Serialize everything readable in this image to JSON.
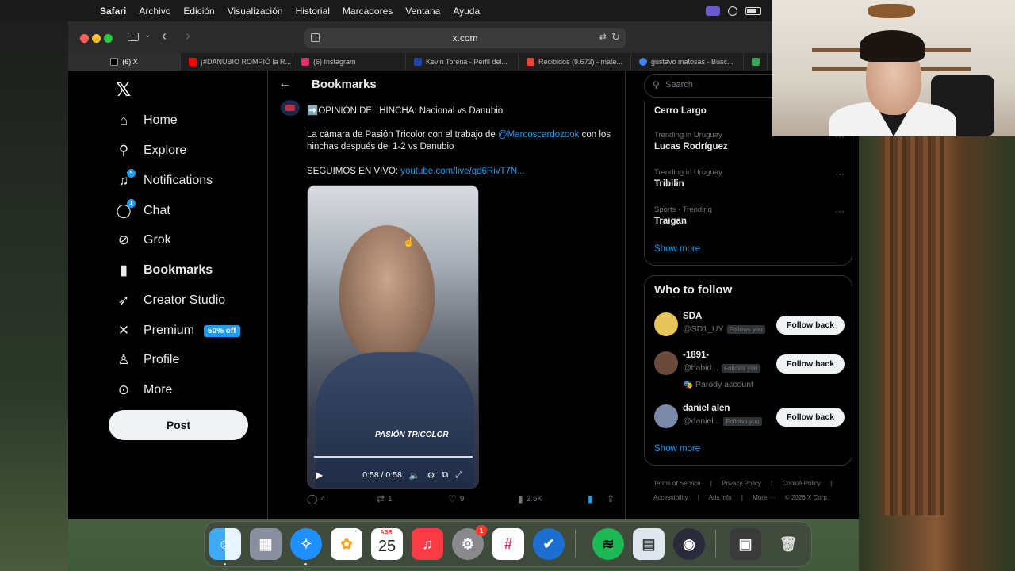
{
  "menubar": {
    "app": "Safari",
    "items": [
      "Archivo",
      "Edición",
      "Visualización",
      "Historial",
      "Marcadores",
      "Ventana",
      "Ayuda"
    ]
  },
  "browser": {
    "url": "x.com",
    "tabs": [
      {
        "label": "(6) X",
        "color": "#ffffff"
      },
      {
        "label": "¡#DANUBIO ROMPIÓ la R...",
        "color": "#ff0000"
      },
      {
        "label": "(6) Instagram",
        "color": "#e1306c"
      },
      {
        "label": "Kevin Torena - Perfil del...",
        "color": "#2244aa"
      },
      {
        "label": "Recibidos (9.673) - mate...",
        "color": "#ea4335"
      },
      {
        "label": "gustavo matosas - Busc...",
        "color": "#4285f4"
      },
      {
        "label": "",
        "color": "#34a853"
      }
    ]
  },
  "nav": {
    "items": [
      {
        "label": "Home",
        "icon": "home-icon",
        "glyph": "⌂"
      },
      {
        "label": "Explore",
        "icon": "search-icon",
        "glyph": "⚲"
      },
      {
        "label": "Notifications",
        "icon": "bell-icon",
        "glyph": "🔔",
        "badge": "5"
      },
      {
        "label": "Chat",
        "icon": "chat-icon",
        "glyph": "💬",
        "badge": "1"
      },
      {
        "label": "Grok",
        "icon": "grok-icon",
        "glyph": "⊘"
      },
      {
        "label": "Bookmarks",
        "icon": "bookmark-icon",
        "glyph": "🔖"
      },
      {
        "label": "Creator Studio",
        "icon": "rocket-icon",
        "glyph": "🚀"
      },
      {
        "label": "Premium",
        "icon": "x-icon",
        "glyph": "𝕏"
      },
      {
        "label": "Profile",
        "icon": "person-icon",
        "glyph": "👤"
      },
      {
        "label": "More",
        "icon": "more-icon",
        "glyph": "⋯"
      }
    ],
    "premium_badge": "50% off",
    "post_label": "Post"
  },
  "main": {
    "title": "Bookmarks",
    "tweet": {
      "headline": "➡️OPINIÓN DEL HINCHA: Nacional vs Danubio",
      "body_pre": "La cámara de Pasión Tricolor con el trabajo de ",
      "mention": "@Marcoscardozook",
      "body_post": " con los hinchas después del 1-2 vs Danubio",
      "live_pre": "SEGUIMOS EN VIVO: ",
      "live_link": "youtube.com/live/qd6RivT7N...",
      "video_logo": "PASIÓN TRICOLOR",
      "video_time": "0:58 / 0:58",
      "replies": "4",
      "reposts": "1",
      "likes": "9",
      "views": "2.6K"
    }
  },
  "right": {
    "search_placeholder": "Search",
    "trends": [
      {
        "meta": "",
        "name": "Cerro Largo"
      },
      {
        "meta": "Trending in Uruguay",
        "name": "Lucas Rodríguez"
      },
      {
        "meta": "Trending in Uruguay",
        "name": "Tribilin"
      },
      {
        "meta": "Sports · Trending",
        "name": "Traigan"
      }
    ],
    "show_more": "Show more",
    "who_to_follow": "Who to follow",
    "follow": [
      {
        "name": "SDA",
        "handle": "@SD1_UY",
        "tag": "Follows you",
        "extra": "",
        "button": "Follow back"
      },
      {
        "name": "-1891-",
        "handle": "@babid...",
        "tag": "Follows you",
        "extra": "🎭 Parody account",
        "button": "Follow back"
      },
      {
        "name": "daniel alen",
        "handle": "@daniel...",
        "tag": "Follows you",
        "extra": "",
        "button": "Follow back"
      }
    ],
    "show_more_2": "Show more",
    "footer": [
      "Terms of Service",
      "|",
      "Privacy Policy",
      "|",
      "Cookie Policy",
      "|",
      "Accessibility",
      "|",
      "Ads info",
      "|",
      "More ···",
      "© 2026 X Corp."
    ]
  },
  "dock": {
    "calendar_month": "ABR.",
    "calendar_day": "25",
    "settings_badge": "1"
  }
}
